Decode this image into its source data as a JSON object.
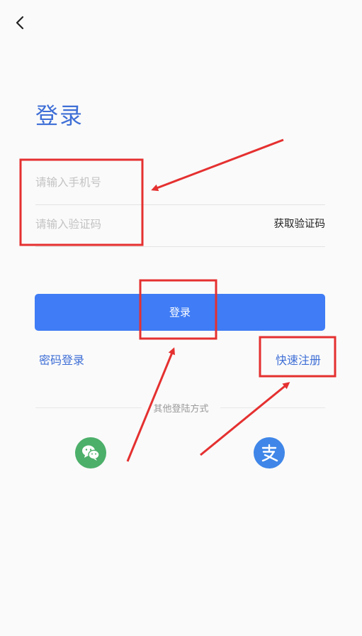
{
  "title": "登录",
  "phone_field": {
    "placeholder": "请输入手机号"
  },
  "code_field": {
    "placeholder": "请输入验证码",
    "get_code_label": "获取验证码"
  },
  "login_button": {
    "label": "登录"
  },
  "links": {
    "password_login": "密码登录",
    "quick_register": "快速注册"
  },
  "other_methods": {
    "label": "其他登陆方式"
  },
  "social_icons": [
    "wechat-icon",
    "alipay-icon"
  ],
  "colors": {
    "accent": "#3f7cf5",
    "title": "#3f6fd6",
    "wechat": "#4caf6a",
    "alipay": "#3f86e8",
    "annotation": "#e53030"
  }
}
